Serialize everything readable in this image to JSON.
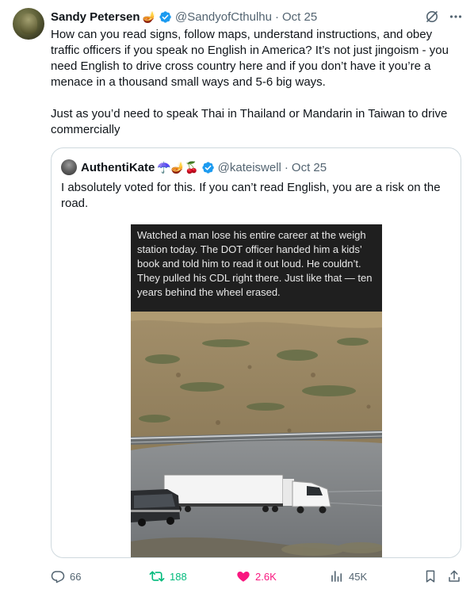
{
  "tweet": {
    "author_name": "Sandy Petersen",
    "author_emoji": "🪔",
    "handle": "@SandyofCthulhu",
    "separator": "·",
    "time": "Oct 25",
    "text_paragraphs": [
      "How can you read signs, follow maps, understand instructions, and obey traffic officers if you speak no English in America? It’s not just jingoism - you need English to drive cross country here and if you don’t have it you’re a menace in a thousand small ways and 5-6 big ways.",
      "Just as you’d need to speak Thai in Thailand or Mandarin in Taiwan to drive commercially"
    ]
  },
  "quote": {
    "author_name": "AuthentiKate",
    "author_emojis": "☂️🪔🍒",
    "handle": "@kateiswell",
    "separator": "·",
    "time": "Oct 25",
    "text": "I absolutely voted for this. If you can’t read English, you are a risk on the road.",
    "media_caption": "Watched a man lose his entire career at the weigh station today. The DOT officer handed him a kids’ book and told him to read it out loud. He couldn’t. They pulled his CDL right there. Just like that — ten years behind the wheel erased."
  },
  "actions": {
    "replies": "66",
    "reposts": "188",
    "likes": "2.6K",
    "views": "45K"
  },
  "colors": {
    "verified": "#1d9bf0",
    "secondary_text": "#536471",
    "repost_active": "#00ba7c",
    "like_active": "#f91880",
    "border": "#cfd9de"
  },
  "icons": [
    "verified-badge-icon",
    "grok-icon",
    "more-icon",
    "reply-icon",
    "repost-icon",
    "like-icon",
    "views-icon",
    "bookmark-icon",
    "share-icon"
  ]
}
